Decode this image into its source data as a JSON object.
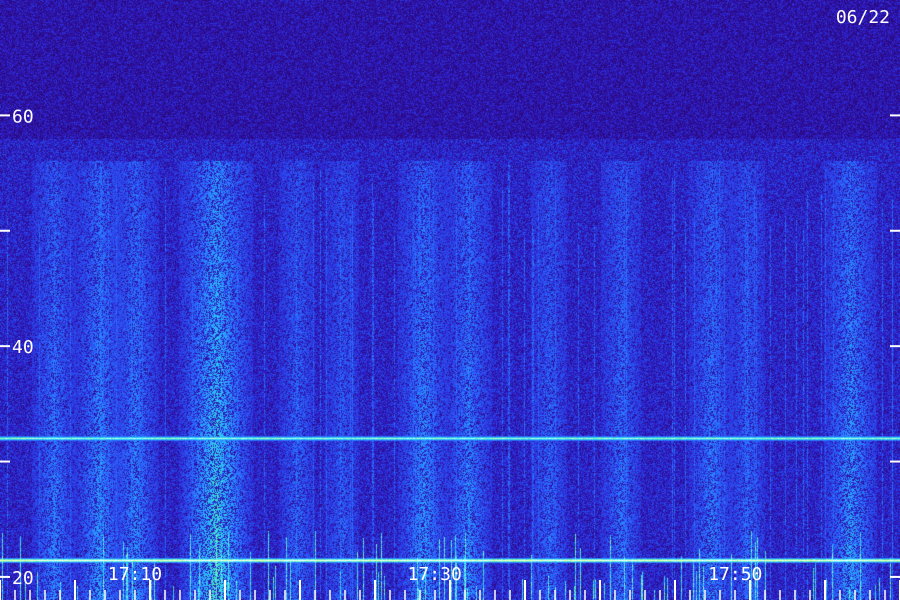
{
  "date_label": "06/22",
  "chart_data": {
    "type": "heatmap",
    "title": "",
    "xlabel": "",
    "ylabel": "",
    "ylim": [
      18,
      70
    ],
    "y_ticks": [
      20,
      40,
      60
    ],
    "y_tick_labels": [
      "20",
      "40",
      "60"
    ],
    "y_minor_ticks": [
      30,
      50
    ],
    "x_tick_labels": [
      {
        "t": 0.15,
        "label": "17:10"
      },
      {
        "t": 0.483,
        "label": "17:30"
      },
      {
        "t": 0.817,
        "label": "17:50"
      }
    ],
    "x_range_minutes": [
      "17:00",
      "18:00"
    ],
    "colormap": [
      "#2a0060",
      "#2f1fd0",
      "#1f6bff",
      "#20c8ff",
      "#7dff60",
      "#ffff40"
    ],
    "horizontal_bands": [
      {
        "y": 32.0,
        "intensity": 0.75
      },
      {
        "y": 21.5,
        "intensity": 0.95
      }
    ],
    "vertical_bursts": [
      {
        "t": 0.06,
        "intensity": 0.45
      },
      {
        "t": 0.11,
        "intensity": 0.55
      },
      {
        "t": 0.15,
        "intensity": 0.5
      },
      {
        "t": 0.24,
        "intensity": 0.9
      },
      {
        "t": 0.33,
        "intensity": 0.35
      },
      {
        "t": 0.38,
        "intensity": 0.3
      },
      {
        "t": 0.47,
        "intensity": 0.55
      },
      {
        "t": 0.52,
        "intensity": 0.5
      },
      {
        "t": 0.61,
        "intensity": 0.35
      },
      {
        "t": 0.69,
        "intensity": 0.4
      },
      {
        "t": 0.79,
        "intensity": 0.45
      },
      {
        "t": 0.83,
        "intensity": 0.35
      },
      {
        "t": 0.945,
        "intensity": 0.6
      }
    ]
  }
}
